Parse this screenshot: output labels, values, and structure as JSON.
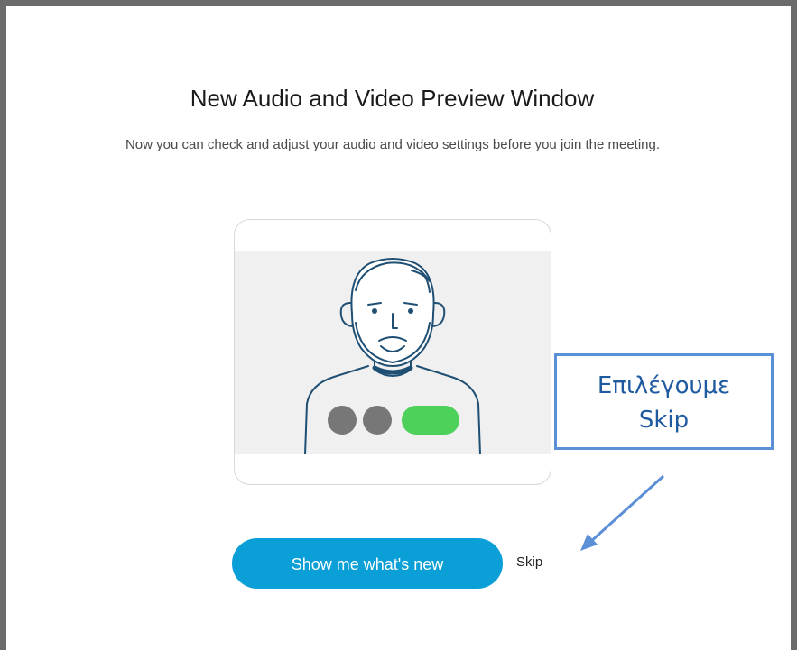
{
  "dialog": {
    "title": "New Audio and Video Preview Window",
    "subtitle": "Now you can check and adjust your audio and video settings before you join the meeting."
  },
  "actions": {
    "primary_label": "Show me what's new",
    "skip_label": "Skip"
  },
  "annotation": {
    "line1": "Επιλέγουμε",
    "line2": "Skip"
  },
  "colors": {
    "primary": "#0a9fd6",
    "callout_border": "#5b8fd6",
    "callout_text": "#1f5aa0",
    "toggle_on": "#4dd15b",
    "toggle_off": "#777777"
  },
  "icons": [
    "avatar-illustration",
    "mic-toggle",
    "video-toggle",
    "audio-connect-toggle",
    "arrow-pointer"
  ]
}
